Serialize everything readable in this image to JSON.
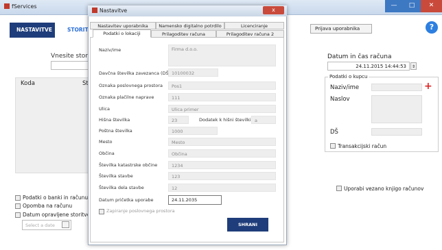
{
  "main": {
    "title": "fServices",
    "nav": {
      "nastavitve": "NASTAVITVE",
      "storitve": "STORITVE",
      "prijava": "Prijava uporabnika",
      "help": "?"
    },
    "search_label": "Vnesite storitev",
    "table": {
      "columns": [
        "Koda",
        "St"
      ]
    },
    "options": {
      "podatki_o_banki": "Podatki o banki in računu",
      "opomba": "Opomba na računu",
      "datum_opravljene": "Datum opravljene storitve",
      "date_placeholder": "Select a date"
    },
    "right": {
      "datetime_title": "Datum in čas računa",
      "datetime_value": "24.11.2015 14:44:53",
      "kupec": {
        "legend": "Podatki o kupcu",
        "naziv": "Naziv/ime",
        "naslov": "Naslov",
        "ds": "DŠ",
        "plus": "+"
      },
      "transakcijski": "Transakcijski račun",
      "vezano": "Uporabi vezano knjigo računov"
    }
  },
  "dialog": {
    "title": "Nastavitve",
    "close": "x",
    "tabs_top": [
      "Nastavitev uporabnika",
      "Namensko digitalno potrdilo",
      "Licenciranje"
    ],
    "tabs_bottom": [
      "Podatki o lokaciji",
      "Prilagoditev računa",
      "Prilagoditev računa 2"
    ],
    "fields": {
      "naziv": {
        "label": "Naziv/ime",
        "value": "Firma d.o.o."
      },
      "davcna": {
        "label": "Davčna številka zavezanca (DŠ)",
        "value": "10100032"
      },
      "ozn_pos": {
        "label": "Oznaka poslovnega prostora",
        "value": "Pos1"
      },
      "ozn_nap": {
        "label": "Oznaka plačilne naprave",
        "value": "111"
      },
      "ulica": {
        "label": "Ulica",
        "value": "Ulica primer"
      },
      "hisna": {
        "label": "Hišna številka",
        "value": "23"
      },
      "dodatek": {
        "label": "Dodatek k hišni številki",
        "value": "a"
      },
      "posta": {
        "label": "Poštna številka",
        "value": "1000"
      },
      "mesto": {
        "label": "Mesto",
        "value": "Mesto"
      },
      "obcina": {
        "label": "Občina",
        "value": "Občina"
      },
      "kat": {
        "label": "Številka katastrske občine",
        "value": "1234"
      },
      "stavba": {
        "label": "Številka stavbe",
        "value": "123"
      },
      "del": {
        "label": "Številka dela stavbe",
        "value": "12"
      },
      "datum": {
        "label": "Datum pričetka uporabe",
        "value": "24.11.2035"
      }
    },
    "zapiranje": "Zapiranje poslovnega prostora",
    "save": "SHRANI"
  }
}
